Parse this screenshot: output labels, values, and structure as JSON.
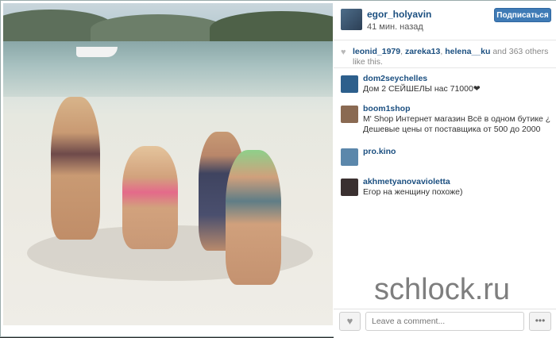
{
  "post": {
    "username": "egor_holyavin",
    "time": "41 мин. назад",
    "follow_label": "Подписаться"
  },
  "likes": {
    "users": [
      "leonid_1979",
      "zareka13",
      "helena__ku"
    ],
    "rest": "and 363 others like this."
  },
  "comments": [
    {
      "user": "dom2seychelles",
      "text": "Дом 2 СЕЙШЕЛЫ нас 71000❤",
      "avatar_color": "#2d5f8c"
    },
    {
      "user": "boom1shop",
      "text": "M' Shop Интернет магазин Всё в одном бутике ¿ Дешевые цены от поставщика от 500 до 2000",
      "avatar_color": "#8a6a52"
    },
    {
      "user": "pro.kino",
      "text": "",
      "avatar_color": "#5b87ab"
    },
    {
      "user": "akhmetyanovavioletta",
      "text": "Егор на женщину похоже)",
      "avatar_color": "#3a3030"
    }
  ],
  "footer": {
    "comment_placeholder": "Leave a comment...",
    "like_icon": "heart-icon",
    "more_icon": "more-dots-icon",
    "more_glyph": "•••",
    "heart_glyph": "♥"
  },
  "watermark": "schlock.ru",
  "colors": {
    "link": "#1b4f80",
    "follow_button": "#3f7bb6"
  }
}
